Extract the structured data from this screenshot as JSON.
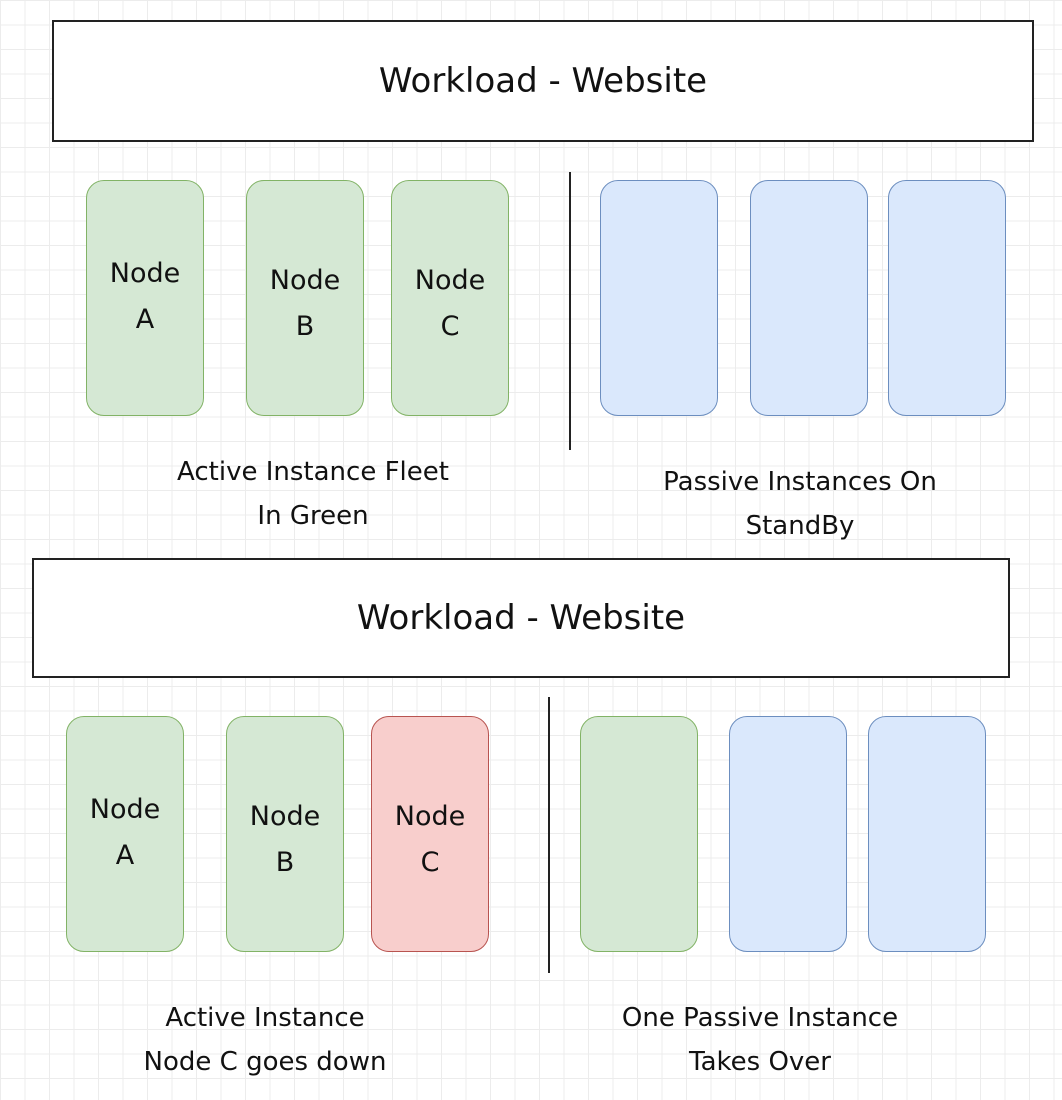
{
  "colors": {
    "active": "#d5e8d4",
    "passive": "#dae8fc",
    "failed": "#f8cecc"
  },
  "top": {
    "title": "Workload - Website",
    "nodes": [
      {
        "line1": "Node",
        "line2": "A",
        "state": "active"
      },
      {
        "line1": "Node",
        "line2": "B",
        "state": "active"
      },
      {
        "line1": "Node",
        "line2": "C",
        "state": "active"
      }
    ],
    "passive": [
      "passive",
      "passive",
      "passive"
    ],
    "caption_left": [
      "Active Instance Fleet",
      "In Green"
    ],
    "caption_right": [
      "Passive Instances On",
      "StandBy"
    ]
  },
  "bottom": {
    "title": "Workload - Website",
    "nodes": [
      {
        "line1": "Node",
        "line2": "A",
        "state": "active"
      },
      {
        "line1": "Node",
        "line2": "B",
        "state": "active"
      },
      {
        "line1": "Node",
        "line2": "C",
        "state": "failed"
      }
    ],
    "passive": [
      "active",
      "passive",
      "passive"
    ],
    "caption_left": [
      "Active Instance",
      "Node C goes down"
    ],
    "caption_right": [
      "One Passive Instance",
      "Takes Over"
    ]
  }
}
